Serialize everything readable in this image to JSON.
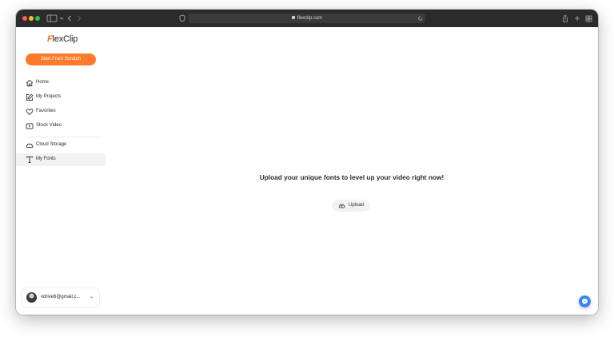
{
  "browser": {
    "address": "flexclip.com"
  },
  "sidebar": {
    "logo": {
      "accent": "F",
      "rest": "lexClip"
    },
    "cta_label": "Start From Scratch",
    "items": [
      {
        "label": "Home",
        "icon": "home-icon"
      },
      {
        "label": "My Projects",
        "icon": "edit-icon"
      },
      {
        "label": "Favorites",
        "icon": "heart-icon"
      },
      {
        "label": "Stock Video",
        "icon": "video-icon"
      },
      {
        "label": "Cloud Storage",
        "icon": "cloud-icon"
      },
      {
        "label": "My Fonts",
        "icon": "text-icon",
        "active": true
      }
    ],
    "user": {
      "email": "vdrive6@gmail.c..."
    }
  },
  "main": {
    "headline": "Upload your unique fonts to level up your video right now!",
    "upload_label": "Upload"
  },
  "colors": {
    "accent": "#ff7a2a",
    "chat": "#3b82f6"
  }
}
